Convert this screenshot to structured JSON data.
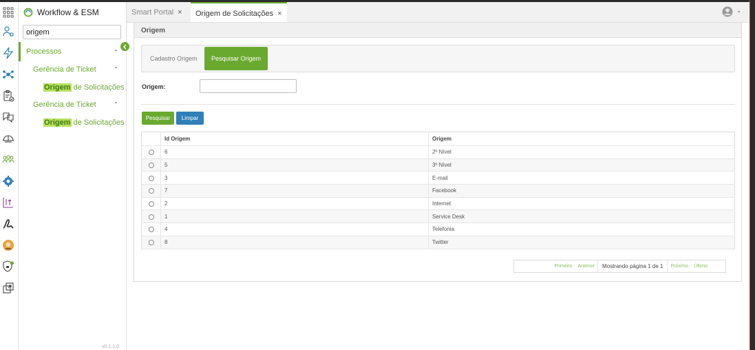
{
  "app": {
    "name": "Workflow & ESM",
    "version": "v0.1.1.0"
  },
  "rail": {
    "icons": [
      "apps-grid-icon",
      "users-settings-icon",
      "lightning-icon",
      "network-icon",
      "clipboard-check-icon",
      "comment-box-icon",
      "helmet-icon",
      "group-icon",
      "gear-icon",
      "chart-icon",
      "signature-icon",
      "avatar-badge-icon",
      "shield-lock-icon",
      "window-export-icon"
    ]
  },
  "sidenav": {
    "search_value": "origem",
    "section_label": "Processos",
    "groups": [
      {
        "label": "Gerência de Ticket",
        "leaf_highlight": "Origem",
        "leaf_rest": " de Solicitações"
      },
      {
        "label": "Gerência de Ticket",
        "leaf_highlight": "Origem",
        "leaf_rest": " de Solicitações"
      }
    ]
  },
  "tabs": [
    {
      "label": "Smart Portal",
      "close": "×",
      "active": false
    },
    {
      "label": "Origem de Solicitações",
      "close": "×",
      "active": true
    }
  ],
  "panel": {
    "title": "Origem",
    "subtabs": [
      {
        "label": "Cadastro Origem",
        "active": false
      },
      {
        "label": "Pesquisar Origem",
        "active": true
      }
    ],
    "form": {
      "label": "Origem:",
      "value": ""
    },
    "buttons": {
      "search": "Pesquisar",
      "clear": "Limpar"
    }
  },
  "table": {
    "columns": [
      "Id Origem",
      "Origem"
    ],
    "rows": [
      [
        "6",
        "2º Nível"
      ],
      [
        "5",
        "3º Nível"
      ],
      [
        "3",
        "E-mail"
      ],
      [
        "7",
        "Facebook"
      ],
      [
        "2",
        "Internet"
      ],
      [
        "1",
        "Service Desk"
      ],
      [
        "4",
        "Telefonia"
      ],
      [
        "8",
        "Twitter"
      ]
    ]
  },
  "pager": {
    "first": "Primeiro",
    "prev": "Anterior",
    "info": "Mostrando página 1 de 1",
    "next": "Próximo",
    "last": "Último"
  },
  "colors": {
    "accent": "#6aa92f",
    "button_blue": "#2f7fb8",
    "highlight": "#b6e05c"
  }
}
